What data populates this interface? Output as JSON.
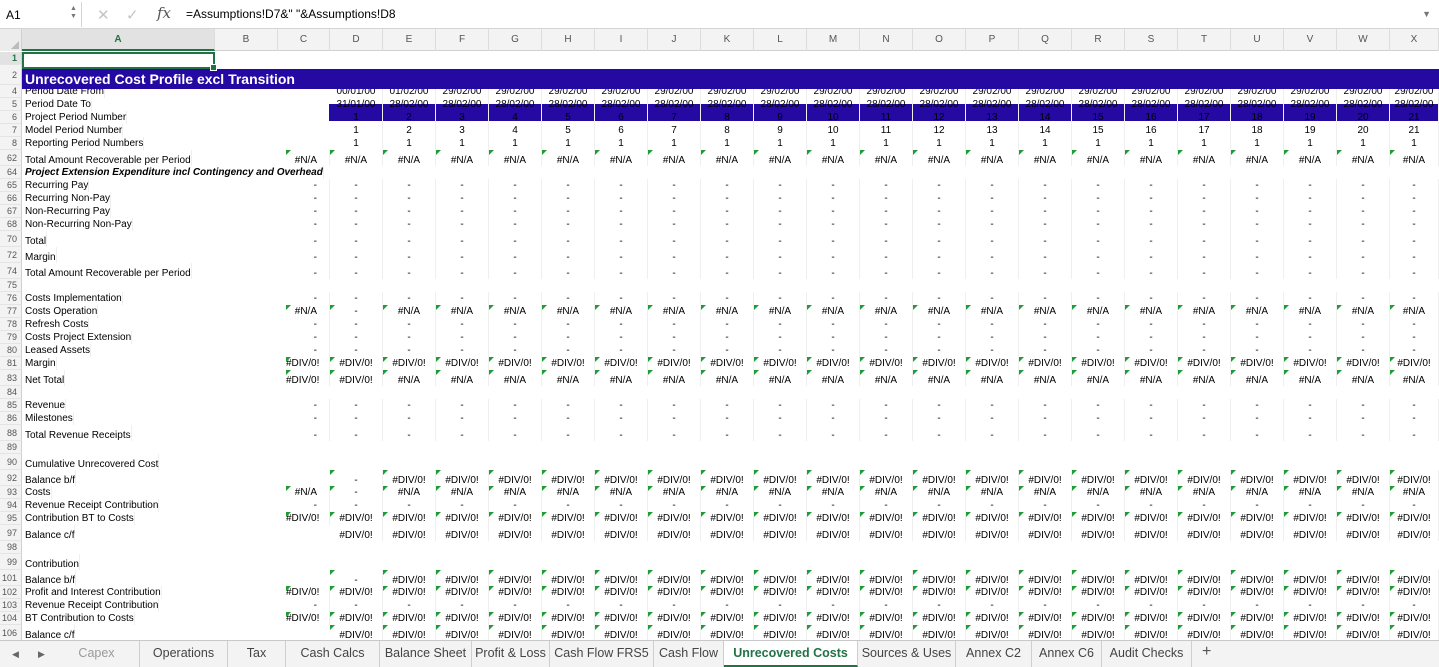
{
  "formula_bar": {
    "cell_ref": "A1",
    "fx": "fx",
    "formula": "=Assumptions!D7&\" \"&Assumptions!D8"
  },
  "columns": [
    "A",
    "B",
    "C",
    "D",
    "E",
    "F",
    "G",
    "H",
    "I",
    "J",
    "K",
    "L",
    "M",
    "N",
    "O",
    "P",
    "Q",
    "R",
    "S",
    "T",
    "U",
    "V",
    "W",
    "X"
  ],
  "sheet_title": "Unrecovered Cost Profile excl Transition",
  "rows": [
    {
      "n": "1",
      "label": "",
      "type": "blank",
      "c": "",
      "vals": []
    },
    {
      "n": "2",
      "label": "",
      "type": "title",
      "c": "",
      "vals": []
    },
    {
      "n": "4",
      "label": "Period Date From",
      "c": "",
      "vals": [
        "00/01/00",
        "01/02/00",
        "29/02/00",
        "29/02/00",
        "29/02/00",
        "29/02/00",
        "29/02/00",
        "29/02/00",
        "29/02/00",
        "29/02/00",
        "29/02/00",
        "29/02/00",
        "29/02/00",
        "29/02/00",
        "29/02/00",
        "29/02/00",
        "29/02/00",
        "29/02/00",
        "29/02/00",
        "29/02/00",
        "29/02/00"
      ]
    },
    {
      "n": "5",
      "label": "Period Date To",
      "c": "",
      "vals": [
        "31/01/00",
        "28/02/00",
        "28/02/00",
        "28/02/00",
        "28/02/00",
        "28/02/00",
        "28/02/00",
        "28/02/00",
        "28/02/00",
        "28/02/00",
        "28/02/00",
        "28/02/00",
        "28/02/00",
        "28/02/00",
        "28/02/00",
        "28/02/00",
        "28/02/00",
        "28/02/00",
        "28/02/00",
        "28/02/00",
        "28/02/00"
      ]
    },
    {
      "n": "6",
      "label": "Project Period Number",
      "c": "",
      "vals": [
        "1",
        "2",
        "3",
        "4",
        "5",
        "6",
        "7",
        "8",
        "9",
        "10",
        "11",
        "12",
        "13",
        "14",
        "15",
        "16",
        "17",
        "18",
        "19",
        "20",
        "21"
      ]
    },
    {
      "n": "7",
      "label": "Model Period Number",
      "c": "",
      "vals": [
        "1",
        "2",
        "3",
        "4",
        "5",
        "6",
        "7",
        "8",
        "9",
        "10",
        "11",
        "12",
        "13",
        "14",
        "15",
        "16",
        "17",
        "18",
        "19",
        "20",
        "21"
      ]
    },
    {
      "n": "8",
      "label": "Reporting Period Numbers",
      "c": "",
      "vals": [
        "1",
        "1",
        "1",
        "1",
        "1",
        "1",
        "1",
        "1",
        "1",
        "1",
        "1",
        "1",
        "1",
        "1",
        "1",
        "1",
        "1",
        "1",
        "1",
        "1",
        "1"
      ]
    },
    {
      "n": "62",
      "label": "Total Amount Recoverable per Period",
      "c": "#N/A",
      "vals": [
        "#N/A",
        "#N/A",
        "#N/A",
        "#N/A",
        "#N/A",
        "#N/A",
        "#N/A",
        "#N/A",
        "#N/A",
        "#N/A",
        "#N/A",
        "#N/A",
        "#N/A",
        "#N/A",
        "#N/A",
        "#N/A",
        "#N/A",
        "#N/A",
        "#N/A",
        "#N/A",
        "#N/A"
      ],
      "mark": true,
      "tall": true
    },
    {
      "n": "64",
      "label": "Project Extension Expenditure incl Contingency and Overhead",
      "type": "hd",
      "c": "",
      "vals": []
    },
    {
      "n": "65",
      "label": "Recurring Pay",
      "c": "-",
      "vals": [
        "-",
        "-",
        "-",
        "-",
        "-",
        "-",
        "-",
        "-",
        "-",
        "-",
        "-",
        "-",
        "-",
        "-",
        "-",
        "-",
        "-",
        "-",
        "-",
        "-",
        "-"
      ]
    },
    {
      "n": "66",
      "label": "Recurring Non-Pay",
      "c": "-",
      "vals": [
        "-",
        "-",
        "-",
        "-",
        "-",
        "-",
        "-",
        "-",
        "-",
        "-",
        "-",
        "-",
        "-",
        "-",
        "-",
        "-",
        "-",
        "-",
        "-",
        "-",
        "-"
      ]
    },
    {
      "n": "67",
      "label": "Non-Recurring Pay",
      "c": "-",
      "vals": [
        "-",
        "-",
        "-",
        "-",
        "-",
        "-",
        "-",
        "-",
        "-",
        "-",
        "-",
        "-",
        "-",
        "-",
        "-",
        "-",
        "-",
        "-",
        "-",
        "-",
        "-"
      ]
    },
    {
      "n": "68",
      "label": "Non-Recurring Non-Pay",
      "c": "-",
      "vals": [
        "-",
        "-",
        "-",
        "-",
        "-",
        "-",
        "-",
        "-",
        "-",
        "-",
        "-",
        "-",
        "-",
        "-",
        "-",
        "-",
        "-",
        "-",
        "-",
        "-",
        "-"
      ]
    },
    {
      "n": "70",
      "label": "Total",
      "c": "-",
      "vals": [
        "-",
        "-",
        "-",
        "-",
        "-",
        "-",
        "-",
        "-",
        "-",
        "-",
        "-",
        "-",
        "-",
        "-",
        "-",
        "-",
        "-",
        "-",
        "-",
        "-",
        "-"
      ],
      "tall": true
    },
    {
      "n": "72",
      "label": "Margin",
      "c": "-",
      "vals": [
        "-",
        "-",
        "-",
        "-",
        "-",
        "-",
        "-",
        "-",
        "-",
        "-",
        "-",
        "-",
        "-",
        "-",
        "-",
        "-",
        "-",
        "-",
        "-",
        "-",
        "-"
      ],
      "tall": true
    },
    {
      "n": "74",
      "label": "Total Amount Recoverable per Period",
      "c": "-",
      "vals": [
        "-",
        "-",
        "-",
        "-",
        "-",
        "-",
        "-",
        "-",
        "-",
        "-",
        "-",
        "-",
        "-",
        "-",
        "-",
        "-",
        "-",
        "-",
        "-",
        "-",
        "-"
      ],
      "tall": true
    },
    {
      "n": "75",
      "label": "",
      "c": "",
      "vals": []
    },
    {
      "n": "76",
      "label": "Costs Implementation",
      "c": "-",
      "vals": [
        "-",
        "-",
        "-",
        "-",
        "-",
        "-",
        "-",
        "-",
        "-",
        "-",
        "-",
        "-",
        "-",
        "-",
        "-",
        "-",
        "-",
        "-",
        "-",
        "-",
        "-"
      ]
    },
    {
      "n": "77",
      "label": "Costs Operation",
      "c": "#N/A",
      "vals": [
        "-",
        "#N/A",
        "#N/A",
        "#N/A",
        "#N/A",
        "#N/A",
        "#N/A",
        "#N/A",
        "#N/A",
        "#N/A",
        "#N/A",
        "#N/A",
        "#N/A",
        "#N/A",
        "#N/A",
        "#N/A",
        "#N/A",
        "#N/A",
        "#N/A",
        "#N/A",
        "#N/A"
      ],
      "mark": true
    },
    {
      "n": "78",
      "label": "Refresh Costs",
      "c": "-",
      "vals": [
        "-",
        "-",
        "-",
        "-",
        "-",
        "-",
        "-",
        "-",
        "-",
        "-",
        "-",
        "-",
        "-",
        "-",
        "-",
        "-",
        "-",
        "-",
        "-",
        "-",
        "-"
      ]
    },
    {
      "n": "79",
      "label": "Costs Project Extension",
      "c": "-",
      "vals": [
        "-",
        "-",
        "-",
        "-",
        "-",
        "-",
        "-",
        "-",
        "-",
        "-",
        "-",
        "-",
        "-",
        "-",
        "-",
        "-",
        "-",
        "-",
        "-",
        "-",
        "-"
      ]
    },
    {
      "n": "80",
      "label": "Leased Assets",
      "c": "-",
      "vals": [
        "-",
        "-",
        "-",
        "-",
        "-",
        "-",
        "-",
        "-",
        "-",
        "-",
        "-",
        "-",
        "-",
        "-",
        "-",
        "-",
        "-",
        "-",
        "-",
        "-",
        "-"
      ]
    },
    {
      "n": "81",
      "label": "Margin",
      "c": "#DIV/0!",
      "vals": [
        "#DIV/0!",
        "#DIV/0!",
        "#DIV/0!",
        "#DIV/0!",
        "#DIV/0!",
        "#DIV/0!",
        "#DIV/0!",
        "#DIV/0!",
        "#DIV/0!",
        "#DIV/0!",
        "#DIV/0!",
        "#DIV/0!",
        "#DIV/0!",
        "#DIV/0!",
        "#DIV/0!",
        "#DIV/0!",
        "#DIV/0!",
        "#DIV/0!",
        "#DIV/0!",
        "#DIV/0!",
        "#DIV/0!"
      ],
      "mark": true
    },
    {
      "n": "83",
      "label": "Net Total",
      "c": "#DIV/0!",
      "vals": [
        "#DIV/0!",
        "#N/A",
        "#N/A",
        "#N/A",
        "#N/A",
        "#N/A",
        "#N/A",
        "#N/A",
        "#N/A",
        "#N/A",
        "#N/A",
        "#N/A",
        "#N/A",
        "#N/A",
        "#N/A",
        "#N/A",
        "#N/A",
        "#N/A",
        "#N/A",
        "#N/A",
        "#N/A"
      ],
      "mark": true,
      "tall": true
    },
    {
      "n": "84",
      "label": "",
      "c": "",
      "vals": []
    },
    {
      "n": "85",
      "label": "Revenue",
      "c": "-",
      "vals": [
        "-",
        "-",
        "-",
        "-",
        "-",
        "-",
        "-",
        "-",
        "-",
        "-",
        "-",
        "-",
        "-",
        "-",
        "-",
        "-",
        "-",
        "-",
        "-",
        "-",
        "-"
      ]
    },
    {
      "n": "86",
      "label": "Milestones",
      "c": "-",
      "vals": [
        "-",
        "-",
        "-",
        "-",
        "-",
        "-",
        "-",
        "-",
        "-",
        "-",
        "-",
        "-",
        "-",
        "-",
        "-",
        "-",
        "-",
        "-",
        "-",
        "-",
        "-"
      ]
    },
    {
      "n": "88",
      "label": "Total Revenue Receipts",
      "c": "-",
      "vals": [
        "-",
        "-",
        "-",
        "-",
        "-",
        "-",
        "-",
        "-",
        "-",
        "-",
        "-",
        "-",
        "-",
        "-",
        "-",
        "-",
        "-",
        "-",
        "-",
        "-",
        "-"
      ],
      "tall": true
    },
    {
      "n": "89",
      "label": "",
      "c": "",
      "vals": []
    },
    {
      "n": "90",
      "label": "Cumulative Unrecovered Cost",
      "c": "",
      "vals": [],
      "tall": true
    },
    {
      "n": "92",
      "label": "Balance b/f",
      "c": "",
      "vals": [
        "-",
        "#DIV/0!",
        "#DIV/0!",
        "#DIV/0!",
        "#DIV/0!",
        "#DIV/0!",
        "#DIV/0!",
        "#DIV/0!",
        "#DIV/0!",
        "#DIV/0!",
        "#DIV/0!",
        "#DIV/0!",
        "#DIV/0!",
        "#DIV/0!",
        "#DIV/0!",
        "#DIV/0!",
        "#DIV/0!",
        "#DIV/0!",
        "#DIV/0!",
        "#DIV/0!",
        "#DIV/0!"
      ],
      "mark": true,
      "tall": true
    },
    {
      "n": "93",
      "label": "Costs",
      "c": "#N/A",
      "vals": [
        "-",
        "#N/A",
        "#N/A",
        "#N/A",
        "#N/A",
        "#N/A",
        "#N/A",
        "#N/A",
        "#N/A",
        "#N/A",
        "#N/A",
        "#N/A",
        "#N/A",
        "#N/A",
        "#N/A",
        "#N/A",
        "#N/A",
        "#N/A",
        "#N/A",
        "#N/A",
        "#N/A"
      ],
      "mark": true
    },
    {
      "n": "94",
      "label": "Revenue Receipt Contribution",
      "c": "-",
      "vals": [
        "-",
        "-",
        "-",
        "-",
        "-",
        "-",
        "-",
        "-",
        "-",
        "-",
        "-",
        "-",
        "-",
        "-",
        "-",
        "-",
        "-",
        "-",
        "-",
        "-",
        "-"
      ]
    },
    {
      "n": "95",
      "label": "Contribution BT to Costs",
      "c": "#DIV/0!",
      "vals": [
        "#DIV/0!",
        "#DIV/0!",
        "#DIV/0!",
        "#DIV/0!",
        "#DIV/0!",
        "#DIV/0!",
        "#DIV/0!",
        "#DIV/0!",
        "#DIV/0!",
        "#DIV/0!",
        "#DIV/0!",
        "#DIV/0!",
        "#DIV/0!",
        "#DIV/0!",
        "#DIV/0!",
        "#DIV/0!",
        "#DIV/0!",
        "#DIV/0!",
        "#DIV/0!",
        "#DIV/0!",
        "#DIV/0!"
      ],
      "mark": true
    },
    {
      "n": "97",
      "label": "Balance c/f",
      "c": "",
      "vals": [
        "#DIV/0!",
        "#DIV/0!",
        "#DIV/0!",
        "#DIV/0!",
        "#DIV/0!",
        "#DIV/0!",
        "#DIV/0!",
        "#DIV/0!",
        "#DIV/0!",
        "#DIV/0!",
        "#DIV/0!",
        "#DIV/0!",
        "#DIV/0!",
        "#DIV/0!",
        "#DIV/0!",
        "#DIV/0!",
        "#DIV/0!",
        "#DIV/0!",
        "#DIV/0!",
        "#DIV/0!",
        "#DIV/0!"
      ],
      "tall": true
    },
    {
      "n": "98",
      "label": "",
      "c": "",
      "vals": []
    },
    {
      "n": "99",
      "label": "Contribution",
      "c": "",
      "vals": [],
      "tall": true
    },
    {
      "n": "101",
      "label": "Balance b/f",
      "c": "",
      "vals": [
        "-",
        "#DIV/0!",
        "#DIV/0!",
        "#DIV/0!",
        "#DIV/0!",
        "#DIV/0!",
        "#DIV/0!",
        "#DIV/0!",
        "#DIV/0!",
        "#DIV/0!",
        "#DIV/0!",
        "#DIV/0!",
        "#DIV/0!",
        "#DIV/0!",
        "#DIV/0!",
        "#DIV/0!",
        "#DIV/0!",
        "#DIV/0!",
        "#DIV/0!",
        "#DIV/0!",
        "#DIV/0!"
      ],
      "mark": true,
      "tall": true
    },
    {
      "n": "102",
      "label": "Profit and Interest Contribution",
      "c": "#DIV/0!",
      "vals": [
        "#DIV/0!",
        "#DIV/0!",
        "#DIV/0!",
        "#DIV/0!",
        "#DIV/0!",
        "#DIV/0!",
        "#DIV/0!",
        "#DIV/0!",
        "#DIV/0!",
        "#DIV/0!",
        "#DIV/0!",
        "#DIV/0!",
        "#DIV/0!",
        "#DIV/0!",
        "#DIV/0!",
        "#DIV/0!",
        "#DIV/0!",
        "#DIV/0!",
        "#DIV/0!",
        "#DIV/0!",
        "#DIV/0!"
      ],
      "mark": true
    },
    {
      "n": "103",
      "label": "Revenue Receipt Contribution",
      "c": "-",
      "vals": [
        "-",
        "-",
        "-",
        "-",
        "-",
        "-",
        "-",
        "-",
        "-",
        "-",
        "-",
        "-",
        "-",
        "-",
        "-",
        "-",
        "-",
        "-",
        "-",
        "-",
        "-"
      ]
    },
    {
      "n": "104",
      "label": "BT Contribution to Costs",
      "c": "#DIV/0!",
      "vals": [
        "#DIV/0!",
        "#DIV/0!",
        "#DIV/0!",
        "#DIV/0!",
        "#DIV/0!",
        "#DIV/0!",
        "#DIV/0!",
        "#DIV/0!",
        "#DIV/0!",
        "#DIV/0!",
        "#DIV/0!",
        "#DIV/0!",
        "#DIV/0!",
        "#DIV/0!",
        "#DIV/0!",
        "#DIV/0!",
        "#DIV/0!",
        "#DIV/0!",
        "#DIV/0!",
        "#DIV/0!",
        "#DIV/0!"
      ],
      "mark": true
    },
    {
      "n": "106",
      "label": "Balance c/f",
      "c": "",
      "vals": [
        "#DIV/0!",
        "#DIV/0!",
        "#DIV/0!",
        "#DIV/0!",
        "#DIV/0!",
        "#DIV/0!",
        "#DIV/0!",
        "#DIV/0!",
        "#DIV/0!",
        "#DIV/0!",
        "#DIV/0!",
        "#DIV/0!",
        "#DIV/0!",
        "#DIV/0!",
        "#DIV/0!",
        "#DIV/0!",
        "#DIV/0!",
        "#DIV/0!",
        "#DIV/0!",
        "#DIV/0!",
        "#DIV/0!"
      ],
      "mark": true,
      "tall": true
    }
  ],
  "tabs": [
    {
      "label": "Capex",
      "state": "faded"
    },
    {
      "label": "Operations"
    },
    {
      "label": "Tax"
    },
    {
      "label": "Cash Calcs"
    },
    {
      "label": "Balance Sheet"
    },
    {
      "label": "Profit & Loss"
    },
    {
      "label": "Cash Flow FRS5"
    },
    {
      "label": "Cash Flow"
    },
    {
      "label": "Unrecovered Costs",
      "state": "active"
    },
    {
      "label": "Sources & Uses"
    },
    {
      "label": "Annex C2"
    },
    {
      "label": "Annex C6"
    },
    {
      "label": "Audit Checks"
    }
  ],
  "add_tab": "+",
  "colors": {
    "banner": "#2409a2",
    "accent": "#217346",
    "error_marker": "#1e9c35"
  }
}
